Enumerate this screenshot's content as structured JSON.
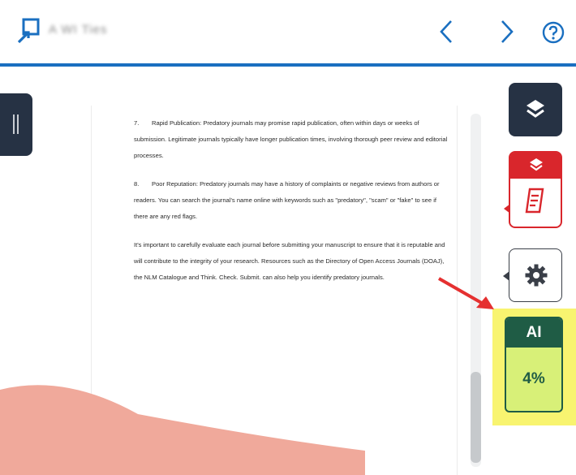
{
  "header": {
    "title": "A WI Ties",
    "accent": "#1a6fc0"
  },
  "document": {
    "paragraphs": [
      {
        "num": "7.",
        "text": "Rapid Publication: Predatory journals may promise rapid publication, often within days or weeks of submission. Legitimate journals typically have longer publication times, involving thorough peer review and editorial processes."
      },
      {
        "num": "8.",
        "text": "Poor Reputation: Predatory journals may have a history of complaints or negative reviews from authors or readers. You can search the journal's name online with keywords such as \"predatory\", \"scam\" or \"fake\" to see if there are any red flags."
      },
      {
        "num": "",
        "text": "It's important to carefully evaluate each journal before submitting your manuscript to ensure that it is reputable and will contribute to the integrity of your research. Resources such as the Directory of Open Access Journals (DOAJ), the NLM Catalogue and Think. Check. Submit. can also help you identify predatory journals."
      }
    ]
  },
  "panel": {
    "ai_label": "AI",
    "ai_value": "4%",
    "colors": {
      "dark": "#263244",
      "similarity": "#d9262c",
      "ai": "#1f5c45",
      "ai_fill": "#d8f078",
      "highlight": "#f8f470",
      "arrow": "#e53030"
    }
  },
  "icons": {
    "logo": "arrow-into-box-icon",
    "prev": "chevron-left-icon",
    "next": "chevron-right-icon",
    "help": "question-circle-icon",
    "layers": "layers-icon",
    "report": "document-icon",
    "settings": "gear-icon"
  }
}
